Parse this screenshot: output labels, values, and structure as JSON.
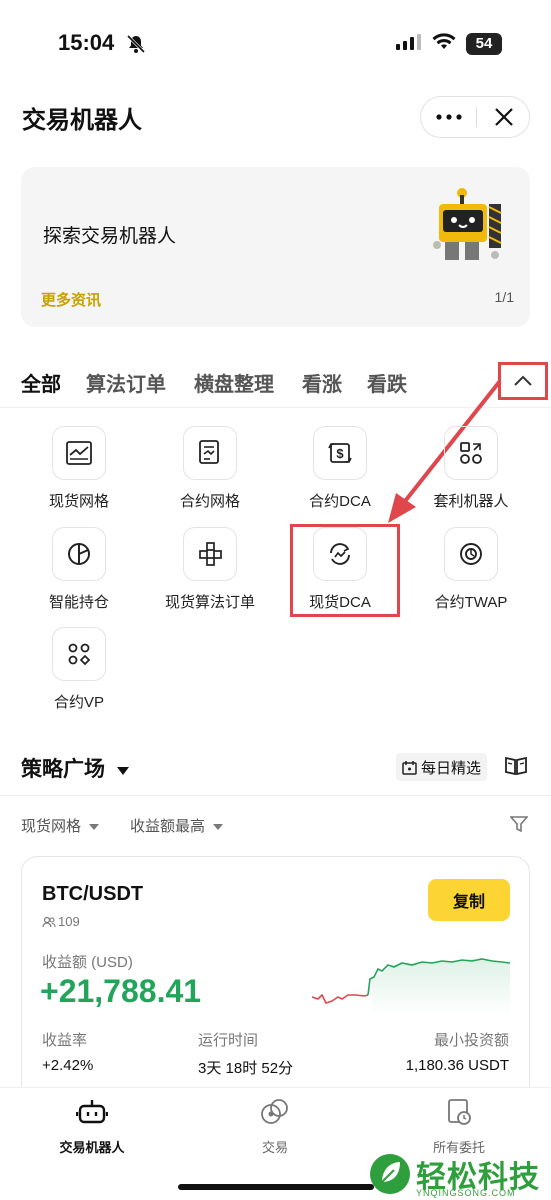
{
  "status_bar": {
    "time": "15:04",
    "battery": "54"
  },
  "header": {
    "title": "交易机器人"
  },
  "banner": {
    "title": "探索交易机器人",
    "link": "更多资讯",
    "page": "1/1"
  },
  "tabs": [
    {
      "label": "全部",
      "active": true
    },
    {
      "label": "算法订单"
    },
    {
      "label": "横盘整理"
    },
    {
      "label": "看涨"
    },
    {
      "label": "看跌"
    }
  ],
  "bots": [
    {
      "label": "现货网格",
      "icon": "grid-chart-icon"
    },
    {
      "label": "合约网格",
      "icon": "document-chart-icon"
    },
    {
      "label": "合约DCA",
      "icon": "dollar-cycle-icon"
    },
    {
      "label": "套利机器人",
      "icon": "arbitrage-icon"
    },
    {
      "label": "智能持仓",
      "icon": "pie-chart-icon"
    },
    {
      "label": "现货算法订单",
      "icon": "algo-blocks-icon"
    },
    {
      "label": "现货DCA",
      "icon": "dca-cycle-icon"
    },
    {
      "label": "合约TWAP",
      "icon": "twap-icon"
    },
    {
      "label": "合约VP",
      "icon": "vp-icon"
    }
  ],
  "strategy": {
    "title": "策略广场",
    "daily_label": "每日精选",
    "filter_type": "现货网格",
    "filter_sort": "收益额最高"
  },
  "card": {
    "pair": "BTC/USDT",
    "users": "109",
    "copy_label": "复制",
    "profit_label": "收益额 (USD)",
    "profit_value": "+21,788.41",
    "rate_label": "收益率",
    "rate_value": "+2.42%",
    "runtime_label": "运行时间",
    "runtime_value": "3天 18时 52分",
    "min_label": "最小投资额",
    "min_value": "1,180.36 USDT"
  },
  "bottom_nav": [
    {
      "label": "交易机器人",
      "active": true
    },
    {
      "label": "交易"
    },
    {
      "label": "所有委托"
    }
  ],
  "watermark": {
    "text": "轻松科技",
    "sub": "YNQINGSONG.COM"
  },
  "colors": {
    "accent": "#fcd535",
    "profit": "#22a55a",
    "loss": "#e0474c",
    "annotation": "#e0474c"
  }
}
